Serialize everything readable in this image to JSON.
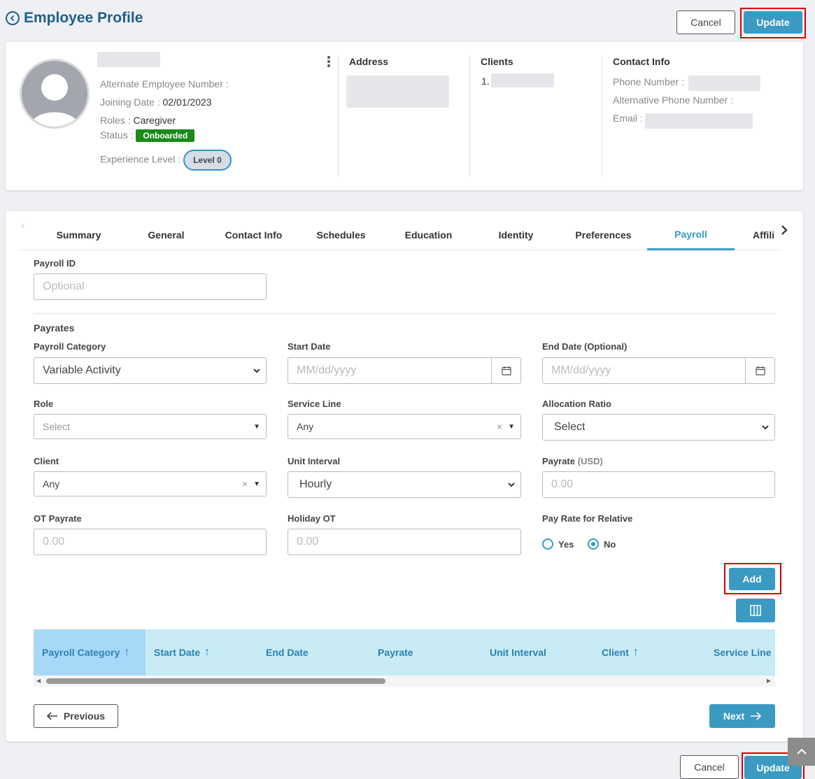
{
  "header": {
    "title": "Employee Profile",
    "cancel_label": "Cancel",
    "update_label": "Update"
  },
  "profile": {
    "alt_emp_label": "Alternate Employee Number :",
    "joining_label": "Joining Date :",
    "joining_value": "02/01/2023",
    "roles_label": "Roles :",
    "roles_value": "Caregiver",
    "status_label": "Status :",
    "status_value": "Onboarded",
    "experience_label": "Experience Level :",
    "experience_value": "Level 0",
    "address_heading": "Address",
    "clients_heading": "Clients",
    "clients_item_index": "1.",
    "contact_heading": "Contact Info",
    "phone_label": "Phone Number :",
    "alt_phone_label": "Alternative Phone Number :",
    "email_label": "Email :"
  },
  "tabs": [
    "Summary",
    "General",
    "Contact Info",
    "Schedules",
    "Education",
    "Identity",
    "Preferences",
    "Payroll",
    "Affili"
  ],
  "active_tab": "Payroll",
  "form": {
    "payroll_id_label": "Payroll ID",
    "payroll_id_placeholder": "Optional",
    "payrates_heading": "Payrates",
    "payroll_category_label": "Payroll Category",
    "payroll_category_value": "Variable Activity",
    "start_date_label": "Start Date",
    "start_date_placeholder": "MM/dd/yyyy",
    "end_date_label": "End Date (Optional)",
    "end_date_placeholder": "MM/dd/yyyy",
    "role_label": "Role",
    "role_placeholder": "Select",
    "service_line_label": "Service Line",
    "service_line_value": "Any",
    "allocation_ratio_label": "Allocation Ratio",
    "allocation_ratio_value": "Select",
    "client_label": "Client",
    "client_value": "Any",
    "unit_interval_label": "Unit Interval",
    "unit_interval_value": "Hourly",
    "payrate_label": "Payrate",
    "payrate_unit": "(USD)",
    "payrate_placeholder": "0.00",
    "ot_payrate_label": "OT Payrate",
    "ot_payrate_placeholder": "0.00",
    "holiday_ot_label": "Holiday OT",
    "holiday_ot_placeholder": "0.00",
    "relative_label": "Pay Rate for Relative",
    "relative_yes": "Yes",
    "relative_no": "No",
    "relative_selected": "No",
    "add_label": "Add"
  },
  "grid": {
    "columns": [
      "Payroll Category",
      "Start Date",
      "End Date",
      "Payrate",
      "Unit Interval",
      "Client",
      "Service Line"
    ]
  },
  "nav": {
    "previous_label": "Previous",
    "next_label": "Next"
  },
  "colors": {
    "accent": "#3a9ac2",
    "title": "#1f5f8b",
    "status_green": "#1a8a1a",
    "highlight": "#dd0000"
  }
}
